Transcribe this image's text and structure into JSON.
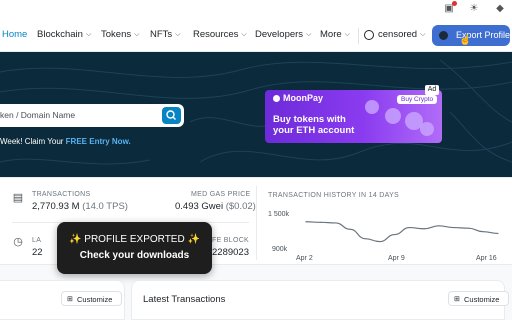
{
  "browser_bar": {
    "icons": [
      "bookmark-icon",
      "settings-icon",
      "ethereum-icon"
    ]
  },
  "nav": {
    "items": [
      {
        "label": "Home"
      },
      {
        "label": "Blockchain"
      },
      {
        "label": "Tokens"
      },
      {
        "label": "NFTs"
      },
      {
        "label": "Resources"
      },
      {
        "label": "Developers"
      },
      {
        "label": "More"
      }
    ],
    "user_label": "censored",
    "export_label": "Export Profile",
    "active_color": "#0784c3",
    "export_color": "#3f6ed1"
  },
  "hero": {
    "search_placeholder": "ken / Domain Name",
    "promo_text": "Week! Claim Your ",
    "promo_link": "FREE Entry Now.",
    "background": "#0b2a3b"
  },
  "ad": {
    "brand": "MoonPay",
    "headline_1": "Buy tokens with",
    "headline_2": "your ETH account",
    "cta": "Buy Crypto",
    "badge": "Ad"
  },
  "stats": {
    "transactions_label": "TRANSACTIONS",
    "transactions_value": "2,770.93 M",
    "transactions_tps": "(14.0 TPS)",
    "gas_label": "MED GAS PRICE",
    "gas_value": "0.493 Gwei",
    "gas_usd": "($0.02)",
    "last_label_partial": "LA",
    "last_value_partial": "22",
    "safe_block_label": "FE BLOCK",
    "safe_block_value": "2289023"
  },
  "chart_data": {
    "type": "line",
    "title": "TRANSACTION HISTORY IN 14 DAYS",
    "x_ticks": [
      "Apr 2",
      "Apr 9",
      "Apr 16"
    ],
    "y_ticks": [
      "1 500k",
      "900k"
    ],
    "ylim": [
      900000,
      1500000
    ],
    "series": [
      {
        "values": [
          1350000,
          1340000,
          1330000,
          1220000,
          1060000,
          1010000,
          1130000,
          1250000,
          1230000,
          1280000,
          1250000,
          1240000,
          1180000,
          1150000
        ]
      }
    ]
  },
  "toast": {
    "line1": "✨ PROFILE EXPORTED ✨",
    "line2": "Check your downloads"
  },
  "cards": {
    "left_customize": "Customize",
    "right_title": "Latest Transactions",
    "right_customize": "Customize"
  }
}
